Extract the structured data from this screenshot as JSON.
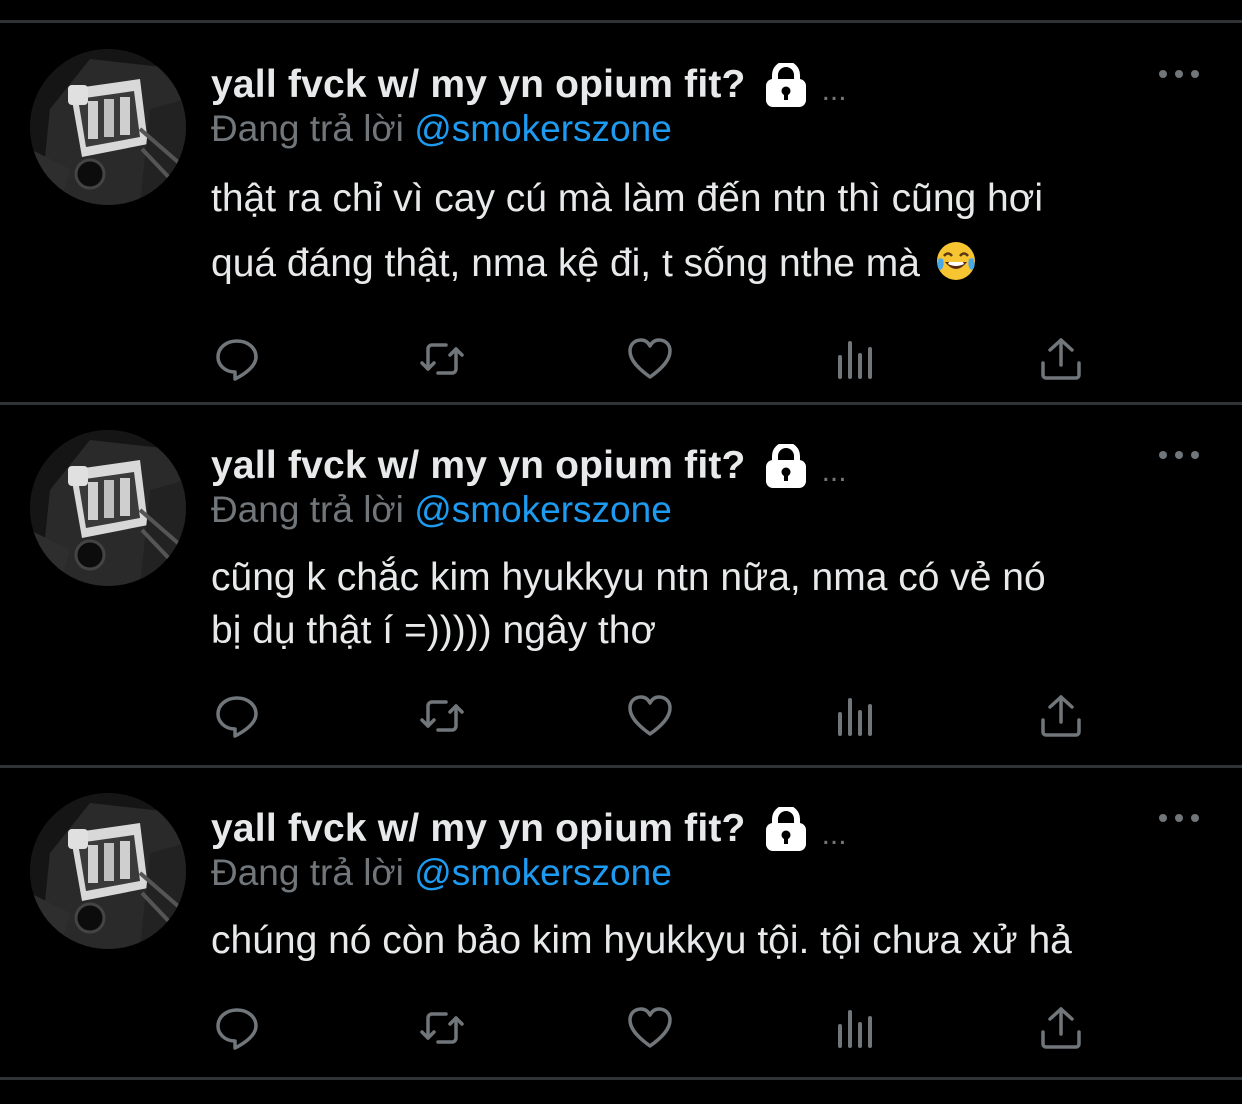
{
  "colors": {
    "background": "#000000",
    "divider": "#2f3336",
    "primary_text": "#e7e9ea",
    "secondary_text": "#71767b",
    "accent": "#1d9bf0"
  },
  "tweets": [
    {
      "display_name": "yall fvck w/ my yn opium fit?",
      "ellipsis": "...",
      "reply_prefix": "Đang trả lời",
      "reply_handle": "@smokerszone",
      "lines": [
        "thật ra chỉ vì cay cú mà làm đến ntn thì cũng hơi",
        "quá đáng thật, nma kệ đi, t sống nthe mà"
      ],
      "trailing_emoji": "face-with-tears-of-joy"
    },
    {
      "display_name": "yall fvck w/ my yn opium fit?",
      "ellipsis": "...",
      "reply_prefix": "Đang trả lời",
      "reply_handle": "@smokerszone",
      "lines": [
        "cũng k chắc kim hyukkyu ntn nữa, nma có vẻ nó",
        "bị dụ thật í =))))) ngây thơ"
      ]
    },
    {
      "display_name": "yall fvck w/ my yn opium fit?",
      "ellipsis": "...",
      "reply_prefix": "Đang trả lời",
      "reply_handle": "@smokerszone",
      "lines": [
        "chúng nó còn bảo kim hyukkyu tội. tội chưa xử hả"
      ]
    }
  ],
  "icons": {
    "lock": "lock-icon",
    "more": "more-horizontal-icon",
    "reply": "reply-icon",
    "retweet": "retweet-icon",
    "like": "heart-icon",
    "analytics": "analytics-icon",
    "share": "share-icon"
  }
}
